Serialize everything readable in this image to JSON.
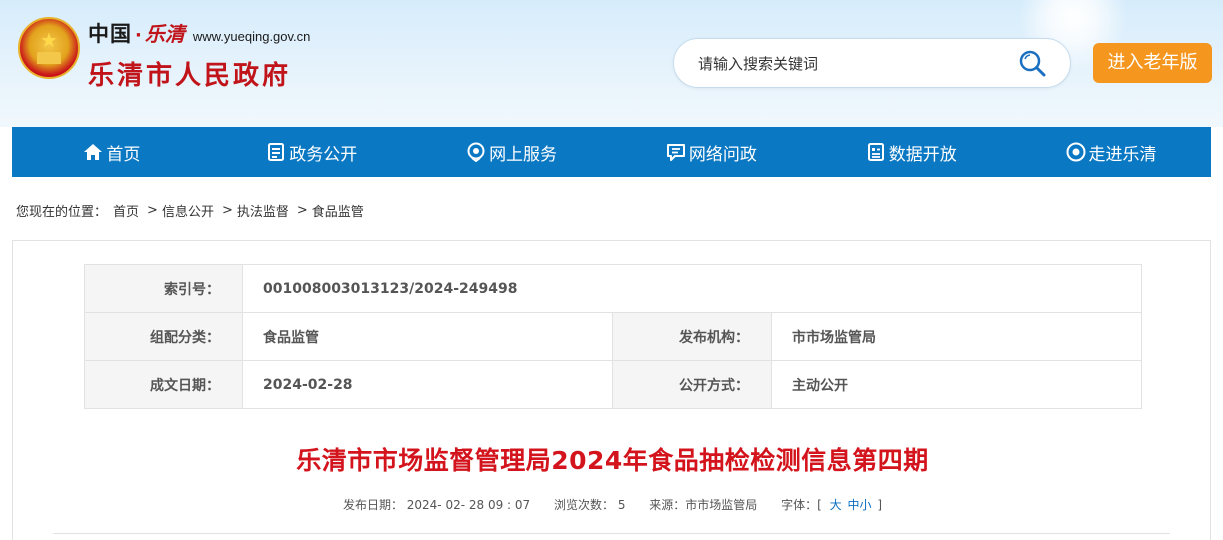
{
  "header": {
    "logo_china": "中国",
    "logo_dot": "·",
    "logo_yueqing": "乐清",
    "logo_url": "www.yueqing.gov.cn",
    "logo_title": "乐清市人民政府",
    "search_placeholder": "请输入搜索关键词",
    "elder_mode_label": "进入老年版"
  },
  "nav": {
    "items": [
      {
        "label": "首页",
        "icon": "home-icon"
      },
      {
        "label": "政务公开",
        "icon": "document-icon"
      },
      {
        "label": "网上服务",
        "icon": "location-icon"
      },
      {
        "label": "网络问政",
        "icon": "chat-icon"
      },
      {
        "label": "数据开放",
        "icon": "data-icon"
      },
      {
        "label": "走进乐清",
        "icon": "eye-icon"
      }
    ]
  },
  "breadcrumb": {
    "prefix": "您现在的位置：",
    "items": [
      "首页",
      "信息公开",
      "执法监督",
      "食品监管"
    ],
    "separator": ">"
  },
  "meta": {
    "index_label": "索引号：",
    "index_value": "001008003013123/2024-249498",
    "category_label": "组配分类：",
    "category_value": "食品监管",
    "publisher_label": "发布机构：",
    "publisher_value": "市市场监管局",
    "date_label": "成文日期：",
    "date_value": "2024-02-28",
    "disclosure_label": "公开方式：",
    "disclosure_value": "主动公开"
  },
  "article": {
    "title": "乐清市市场监督管理局2024年食品抽检检测信息第四期",
    "publish_date": "发布日期： 2024- 02- 28 09 : 07",
    "views": "浏览次数： 5",
    "source": "来源：市市场监管局",
    "font_size_label": "字体：[",
    "font_large": "大",
    "font_medium": "中",
    "font_small": "小",
    "font_size_close": "]"
  },
  "colors": {
    "nav_bg": "#0b78c3",
    "title_red": "#d3141c",
    "elder_orange": "#f5961e"
  }
}
